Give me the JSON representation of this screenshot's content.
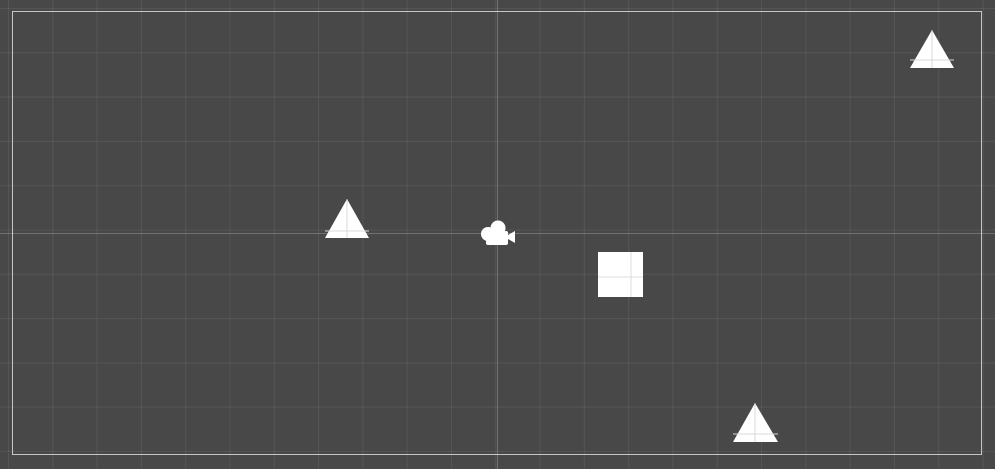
{
  "scene_view": {
    "objects": [
      {
        "kind": "triangle",
        "icon": "triangle-sprite-icon"
      },
      {
        "kind": "triangle",
        "icon": "triangle-sprite-icon"
      },
      {
        "kind": "triangle",
        "icon": "triangle-sprite-icon"
      },
      {
        "kind": "square",
        "icon": "square-sprite-icon"
      },
      {
        "kind": "camera",
        "icon": "camera-gizmo-icon"
      }
    ],
    "colors": {
      "background": "#484848",
      "sprite": "#ffffff",
      "bounds": "#e6e6e6"
    }
  }
}
